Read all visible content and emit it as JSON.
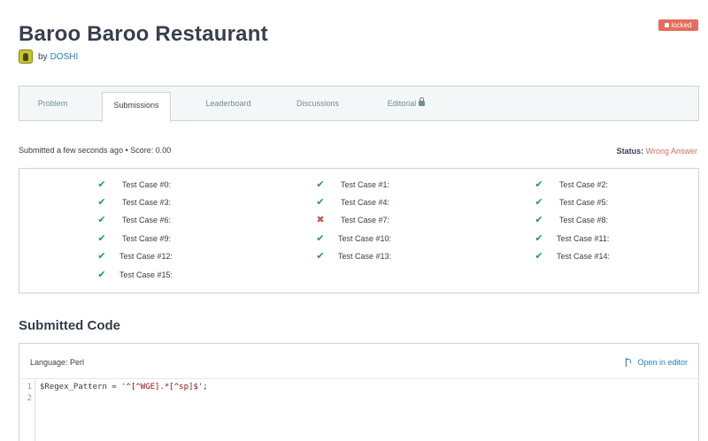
{
  "challenge": {
    "title": "Baroo Baroo Restaurant",
    "locked_badge": "locked",
    "by_label": "by",
    "author": "DOSHI"
  },
  "tabs": [
    {
      "label": "Problem",
      "active": false
    },
    {
      "label": "Submissions",
      "active": true
    },
    {
      "label": "Leaderboard",
      "active": false
    },
    {
      "label": "Discussions",
      "active": false
    },
    {
      "label": "Editorial",
      "active": false,
      "locked": true
    }
  ],
  "submission": {
    "info": "Submitted a few seconds ago • Score: 0.00",
    "status_label": "Status:",
    "status_value": "Wrong Answer"
  },
  "test_cases": [
    {
      "label": "Test Case #0:",
      "result": "pass"
    },
    {
      "label": "Test Case #1:",
      "result": "pass"
    },
    {
      "label": "Test Case #2:",
      "result": "pass"
    },
    {
      "label": "Test Case #3:",
      "result": "pass"
    },
    {
      "label": "Test Case #4:",
      "result": "pass"
    },
    {
      "label": "Test Case #5:",
      "result": "pass"
    },
    {
      "label": "Test Case #6:",
      "result": "pass"
    },
    {
      "label": "Test Case #7:",
      "result": "fail"
    },
    {
      "label": "Test Case #8:",
      "result": "pass"
    },
    {
      "label": "Test Case #9:",
      "result": "pass"
    },
    {
      "label": "Test Case #10:",
      "result": "pass"
    },
    {
      "label": "Test Case #11:",
      "result": "pass"
    },
    {
      "label": "Test Case #12:",
      "result": "pass"
    },
    {
      "label": "Test Case #13:",
      "result": "pass"
    },
    {
      "label": "Test Case #14:",
      "result": "pass"
    },
    {
      "label": "Test Case #15:",
      "result": "pass"
    }
  ],
  "code_section": {
    "heading": "Submitted Code",
    "language": "Language: Perl",
    "open_in_editor": "Open in editor",
    "line_numbers": [
      "1",
      "2"
    ],
    "code_prefix": "$Regex_Pattern = ",
    "code_string": "'^[^WGE].*[^sp]$'",
    "code_suffix": ";"
  },
  "colors": {
    "accent_link": "#1f8acb",
    "pass": "#1ba94c",
    "fail": "#d9534f",
    "wrong_answer": "#e86c5e",
    "locked_badge": "#e86c5e"
  },
  "icons": {
    "pass": "check-icon",
    "fail": "cross-icon",
    "editorial_lock": "lock-icon",
    "open_editor": "branch-icon"
  }
}
